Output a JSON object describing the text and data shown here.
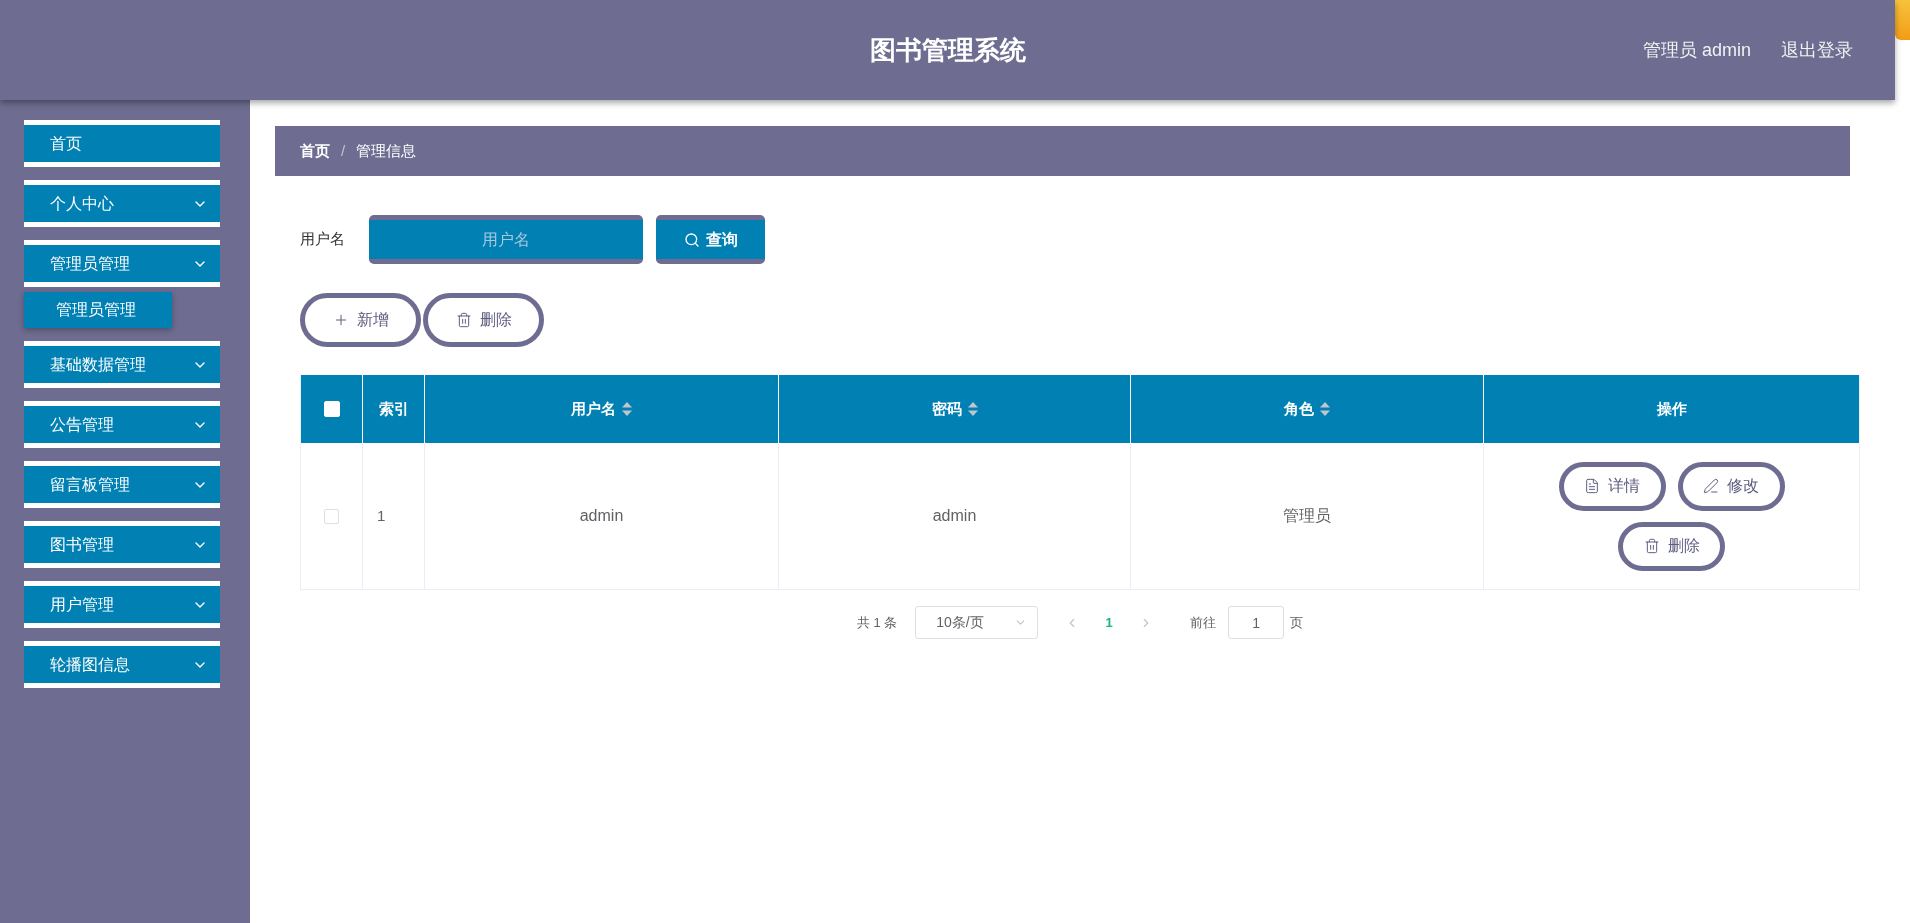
{
  "header": {
    "title": "图书管理系统",
    "user": "管理员 admin",
    "logout": "退出登录"
  },
  "sidebar": {
    "items": [
      {
        "label": "首页",
        "kind": "link"
      },
      {
        "label": "个人中心",
        "kind": "submenu"
      },
      {
        "label": "管理员管理",
        "kind": "submenu",
        "children": [
          {
            "label": "管理员管理"
          }
        ]
      },
      {
        "label": "基础数据管理",
        "kind": "submenu"
      },
      {
        "label": "公告管理",
        "kind": "submenu"
      },
      {
        "label": "留言板管理",
        "kind": "submenu"
      },
      {
        "label": "图书管理",
        "kind": "submenu"
      },
      {
        "label": "用户管理",
        "kind": "submenu"
      },
      {
        "label": "轮播图信息",
        "kind": "submenu"
      }
    ]
  },
  "breadcrumb": {
    "separator": "/",
    "items": [
      {
        "label": "首页",
        "kind": "link"
      },
      {
        "label": "管理信息",
        "kind": "current"
      }
    ]
  },
  "search": {
    "label": "用户名",
    "placeholder": "用户名",
    "button": "查询"
  },
  "actions": [
    {
      "label": "新增",
      "kind": "add"
    },
    {
      "label": "删除",
      "kind": "delete"
    }
  ],
  "table": {
    "columns": [
      {
        "kind": "checkbox",
        "checked": false
      },
      {
        "kind": "text",
        "label": "索引",
        "sortable": false
      },
      {
        "kind": "text",
        "label": "用户名",
        "sortable": true
      },
      {
        "kind": "text",
        "label": "密码",
        "sortable": true
      },
      {
        "kind": "text",
        "label": "角色",
        "sortable": true
      },
      {
        "kind": "text",
        "label": "操作",
        "sortable": false
      }
    ],
    "rows": [
      {
        "cells": [
          {
            "kind": "checkbox",
            "checked": false
          },
          {
            "kind": "index",
            "text": "1"
          },
          {
            "kind": "text",
            "text": "admin"
          },
          {
            "kind": "text",
            "text": "admin"
          },
          {
            "kind": "text",
            "text": "管理员"
          },
          {
            "kind": "actions",
            "actions": [
              {
                "label": "详情",
                "kind": "detail"
              },
              {
                "label": "修改",
                "kind": "edit"
              },
              {
                "label": "删除",
                "kind": "delete"
              }
            ]
          }
        ]
      }
    ]
  },
  "pagination": {
    "total": "共 1 条",
    "page_size": "10条/页",
    "pages": [
      {
        "label": "1",
        "selected": true
      }
    ],
    "goto_label": "前往",
    "goto_value": "1",
    "goto_suffix": "页"
  }
}
